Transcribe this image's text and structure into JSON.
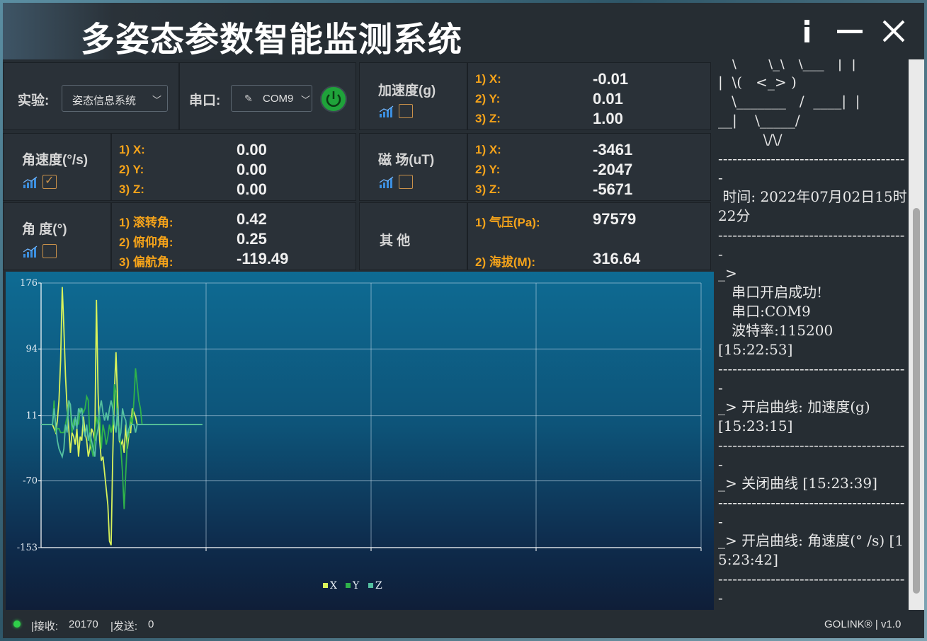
{
  "app": {
    "title": "多姿态参数智能监测系统"
  },
  "controls": {
    "experiment_label": "实验:",
    "experiment_value": "姿态信息系统",
    "port_label": "串口:",
    "port_value": "COM9"
  },
  "accel": {
    "label": "加速度(g)",
    "x_lbl": "1) X:",
    "y_lbl": "2) Y:",
    "z_lbl": "3) Z:",
    "x": "-0.01",
    "y": "0.01",
    "z": "1.00",
    "checked": false
  },
  "gyro": {
    "label": "角速度(°/s)",
    "x_lbl": "1) X:",
    "y_lbl": "2) Y:",
    "z_lbl": "3) Z:",
    "x": "0.00",
    "y": "0.00",
    "z": "0.00",
    "checked": true
  },
  "mag": {
    "label": "磁  场(uT)",
    "x_lbl": "1) X:",
    "y_lbl": "2) Y:",
    "z_lbl": "3) Z:",
    "x": "-3461",
    "y": "-2047",
    "z": "-5671",
    "checked": false
  },
  "angle": {
    "label": "角  度(°)",
    "roll_lbl": "1) 滚转角:",
    "pitch_lbl": "2) 俯仰角:",
    "yaw_lbl": "3) 偏航角:",
    "roll": "0.42",
    "pitch": "0.25",
    "yaw": "-119.49",
    "checked": false
  },
  "other": {
    "label": "其  他",
    "pressure_lbl": "1) 气压(Pa):",
    "altitude_lbl": "2) 海拔(M):",
    "pressure": "97579",
    "altitude": "316.64"
  },
  "log": {
    "text": "   \\       \\_\\   \\___   |  |\n|  \\(   <_> )\n   \\_______   /  ____|  |\n__|    \\_____/\n          \\/\\/\n----------------------------------------\n 时间: 2022年07月02日15时22分\n----------------------------------------\n_>\n   串口开启成功!\n   串口:COM9\n   波特率:115200\n[15:22:53]\n----------------------------------------\n_> 开启曲线: 加速度(g)\n[15:23:15]\n----------------------------------------\n_> 关闭曲线 [15:23:39]\n----------------------------------------\n_> 开启曲线: 角速度(° /s) [15:23:42]\n----------------------------------------"
  },
  "status": {
    "receive_label": "|接收:",
    "receive_value": "20170",
    "send_label": "|发送:",
    "send_value": "0",
    "brand": "GOLINK® | v1.0"
  },
  "colors": {
    "accent_orange": "#f5a31a",
    "series_x": "#d8f25a",
    "series_y": "#2fb24a",
    "series_z": "#54c0a0",
    "power_green": "#1fa33a"
  },
  "chart_data": {
    "type": "line",
    "ylim": [
      -153,
      176
    ],
    "yticks": [
      "176",
      "94",
      "11",
      "-70",
      "-153"
    ],
    "legend": [
      "X",
      "Y",
      "Z"
    ],
    "x": [
      0,
      1,
      2,
      3,
      4,
      5,
      6,
      7,
      8,
      9,
      10,
      11,
      12,
      13,
      14,
      15,
      16,
      17,
      18,
      19,
      20,
      21,
      22,
      23,
      24,
      25,
      26,
      27,
      28,
      29,
      30,
      31,
      32,
      33,
      34,
      35,
      36,
      37,
      38,
      39,
      40,
      41,
      42,
      43,
      44,
      45,
      46,
      47,
      48,
      49,
      50,
      51,
      52,
      53,
      54,
      55,
      56,
      57,
      58,
      59,
      60,
      61,
      62,
      63,
      64,
      65,
      66,
      67,
      68,
      69,
      70,
      71,
      72,
      73,
      74,
      75,
      76,
      77,
      78,
      79,
      80,
      81,
      82,
      83,
      84,
      85,
      86,
      87,
      88,
      89,
      90,
      91,
      92,
      93,
      94,
      95,
      96,
      97,
      98,
      99
    ],
    "series": [
      {
        "name": "X",
        "values": [
          0,
          0,
          0,
          0,
          0,
          0,
          0,
          0,
          -5,
          -10,
          5,
          30,
          80,
          171,
          120,
          60,
          20,
          -5,
          -35,
          -10,
          -15,
          -25,
          -5,
          -40,
          -15,
          -20,
          10,
          -10,
          -20,
          -40,
          -30,
          -5,
          -10,
          -20,
          155,
          40,
          -20,
          -45,
          -40,
          -60,
          -80,
          -100,
          -145,
          -150,
          -40,
          40,
          90,
          30,
          -20,
          -25,
          -20,
          -35,
          0,
          -30,
          -10,
          -10,
          20,
          15,
          10,
          0,
          0,
          0,
          0,
          0,
          0,
          0,
          0,
          0,
          0,
          0,
          0,
          0,
          0,
          0,
          0,
          0,
          0,
          0,
          0,
          0,
          0,
          0,
          0,
          0,
          0,
          0,
          0,
          0,
          0,
          0,
          0,
          0,
          0,
          0,
          0,
          0,
          0,
          0,
          0,
          0
        ]
      },
      {
        "name": "Y",
        "values": [
          0,
          0,
          0,
          0,
          0,
          0,
          0,
          0,
          30,
          -10,
          -5,
          -5,
          -10,
          -10,
          -10,
          0,
          10,
          30,
          20,
          -10,
          5,
          0,
          5,
          0,
          20,
          20,
          15,
          20,
          35,
          30,
          -20,
          -30,
          -40,
          -15,
          10,
          0,
          10,
          -30,
          0,
          -10,
          -25,
          -15,
          0,
          -10,
          0,
          50,
          40,
          0,
          -5,
          -30,
          -60,
          -105,
          -60,
          -20,
          -10,
          10,
          0,
          30,
          70,
          50,
          30,
          20,
          0,
          0,
          0,
          0,
          0,
          0,
          0,
          0,
          0,
          0,
          0,
          0,
          0,
          0,
          0,
          0,
          0,
          0,
          0,
          0,
          0,
          0,
          0,
          0,
          0,
          0,
          0,
          0,
          0,
          0,
          0,
          0,
          0,
          0,
          0,
          0,
          0,
          0
        ]
      },
      {
        "name": "Z",
        "values": [
          0,
          0,
          0,
          0,
          0,
          0,
          0,
          0,
          20,
          0,
          -20,
          -30,
          -35,
          -40,
          -30,
          0,
          -10,
          30,
          25,
          0,
          -5,
          10,
          -5,
          20,
          15,
          20,
          -5,
          -15,
          0,
          -20,
          -10,
          -20,
          -30,
          -40,
          -15,
          -5,
          20,
          30,
          15,
          5,
          15,
          5,
          20,
          30,
          20,
          0,
          -10,
          20,
          -20,
          -10,
          20,
          10,
          5,
          -15,
          -5,
          0,
          0,
          0,
          -10,
          0,
          0,
          0,
          0,
          0,
          0,
          0,
          0,
          0,
          0,
          0,
          0,
          0,
          0,
          0,
          0,
          0,
          0,
          0,
          0,
          0,
          0,
          0,
          0,
          0,
          0,
          0,
          0,
          0,
          0,
          0,
          0,
          0,
          0,
          0,
          0,
          0,
          0,
          0,
          0,
          0
        ]
      }
    ]
  }
}
